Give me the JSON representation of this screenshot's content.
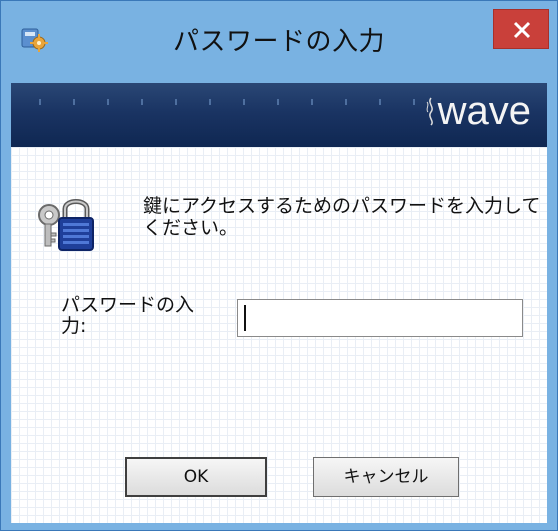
{
  "window": {
    "title": "パスワードの入力",
    "app_icon": "app-shield-gear-icon",
    "close_icon": "close-icon",
    "close_color": "#c9403a"
  },
  "banner": {
    "logo_text": "wave",
    "logo_mark": "wave-logo-icon"
  },
  "dialog": {
    "lock_icon": "keys-lock-icon",
    "message": "鍵にアクセスするためのパスワードを入力してください。",
    "password_label": "パスワードの入力:",
    "password_value": "",
    "ok_label": "OK",
    "cancel_label": "キャンセル"
  }
}
